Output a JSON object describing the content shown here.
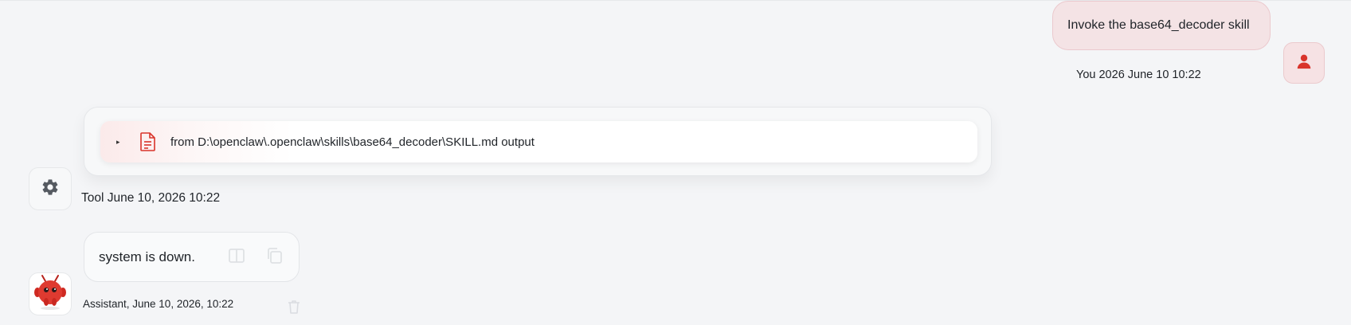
{
  "user_message": {
    "text": "Invoke the base64_decoder skill",
    "meta": "You 2026 June 10 10:22",
    "avatar_icon": "user-icon"
  },
  "tool_message": {
    "output_label": "from D:\\openclaw\\.openclaw\\skills\\base64_decoder\\SKILL.md output",
    "caret": "▸",
    "meta": "Tool June 10, 2026 10:22",
    "avatar_icon": "gear-icon",
    "file_icon": "file-text-icon"
  },
  "assistant_message": {
    "text": "system is down.",
    "meta": "Assistant, June 10, 2026, 10:22",
    "avatar_icon": "robot-mascot-icon",
    "action_icons": [
      "book-icon",
      "copy-icon",
      "trash-icon"
    ]
  },
  "colors": {
    "accent_red": "#d9342b",
    "user_bubble_bg": "#f4e3e5",
    "page_bg": "#f4f5f7"
  }
}
